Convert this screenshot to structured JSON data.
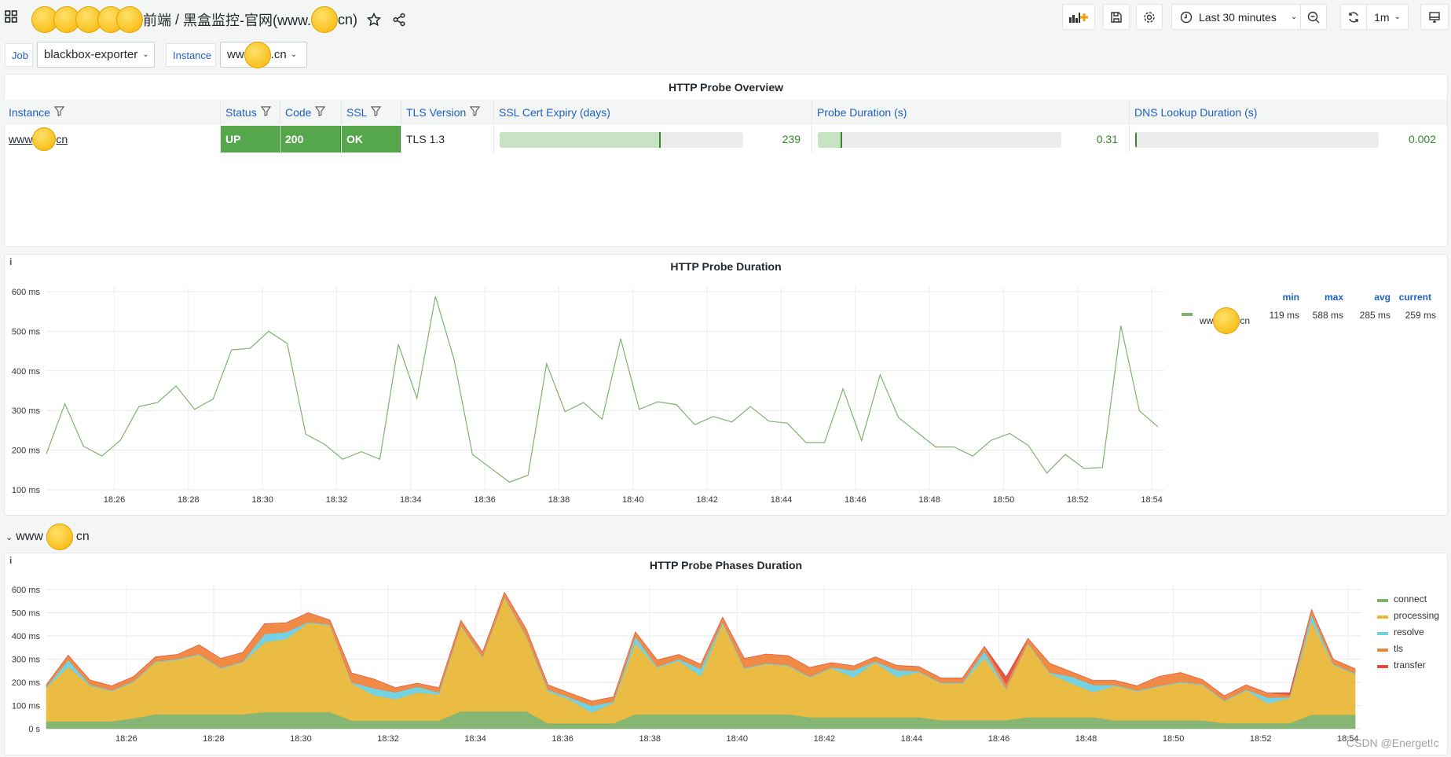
{
  "header": {
    "title_prefix": "前端",
    "title_sep": " / ",
    "title_main": "黑盒监控-官网(www.",
    "title_suffix": "cn)",
    "icons": [
      "apps-icon",
      "star-icon",
      "share-icon"
    ],
    "toolbar": {
      "time_range": "Last 30 minutes",
      "refresh_interval": "1m",
      "icons": [
        "add-panel-icon",
        "save-icon",
        "settings-icon",
        "clock-icon",
        "zoom-out-icon",
        "refresh-icon",
        "tv-mode-icon"
      ]
    }
  },
  "variables": [
    {
      "label": "Job",
      "value": "blackbox-exporter"
    },
    {
      "label": "Instance",
      "value_prefix": "ww",
      "value_suffix": ".cn"
    }
  ],
  "overview": {
    "title": "HTTP Probe Overview",
    "columns": [
      "Instance",
      "Status",
      "Code",
      "SSL",
      "TLS Version",
      "SSL Cert Expiry (days)",
      "Probe Duration (s)",
      "DNS Lookup Duration (s)"
    ],
    "row": {
      "instance_prefix": "www",
      "instance_suffix": "cn",
      "status": "UP",
      "code": "200",
      "ssl": "OK",
      "tls_version": "TLS 1.3",
      "ssl_cert_expiry": "239",
      "ssl_cert_expiry_fill": 0.66,
      "probe_duration": "0.31",
      "probe_duration_fill": 0.1,
      "dns_lookup": "0.002",
      "dns_lookup_fill": 0.005
    },
    "colors": {
      "ok": "#56a64b",
      "gauge": "#c8e3c3",
      "value": "#37872d"
    }
  },
  "row_header": {
    "prefix": "www",
    "suffix": "cn"
  },
  "chart_data": [
    {
      "type": "line",
      "title": "HTTP Probe Duration",
      "info_icon": "i",
      "ylim": [
        100,
        600
      ],
      "y_ticks": [
        "100 ms",
        "200 ms",
        "300 ms",
        "400 ms",
        "500 ms",
        "600 ms"
      ],
      "x_ticks": [
        "18:26",
        "18:28",
        "18:30",
        "18:32",
        "18:34",
        "18:36",
        "18:38",
        "18:40",
        "18:42",
        "18:44",
        "18:46",
        "18:48",
        "18:50",
        "18:52",
        "18:54"
      ],
      "grid": true,
      "legend_placement": "right",
      "legend": {
        "headers": [
          "min",
          "max",
          "avg",
          "current"
        ],
        "series_prefix": "ww",
        "series_suffix": "cn",
        "values": [
          "119 ms",
          "588 ms",
          "285 ms",
          "259 ms"
        ]
      },
      "color": "#7eb26d",
      "x": [
        "18:24:10",
        "18:24:40",
        "18:25:10",
        "18:25:40",
        "18:26:10",
        "18:26:40",
        "18:27:10",
        "18:27:40",
        "18:28:10",
        "18:28:40",
        "18:29:10",
        "18:29:40",
        "18:30:10",
        "18:30:40",
        "18:31:10",
        "18:31:40",
        "18:32:10",
        "18:32:40",
        "18:33:10",
        "18:33:40",
        "18:34:10",
        "18:34:40",
        "18:35:10",
        "18:35:40",
        "18:36:10",
        "18:36:40",
        "18:37:10",
        "18:37:40",
        "18:38:10",
        "18:38:40",
        "18:39:10",
        "18:39:40",
        "18:40:10",
        "18:40:40",
        "18:41:10",
        "18:41:40",
        "18:42:10",
        "18:42:40",
        "18:43:10",
        "18:43:40",
        "18:44:10",
        "18:44:40",
        "18:45:10",
        "18:45:40",
        "18:46:10",
        "18:46:40",
        "18:47:10",
        "18:47:40",
        "18:48:10",
        "18:48:40",
        "18:49:10",
        "18:49:40",
        "18:50:10",
        "18:50:40",
        "18:51:10",
        "18:51:40",
        "18:52:10",
        "18:52:40",
        "18:53:10",
        "18:53:40",
        "18:54:10"
      ],
      "values": [
        190,
        317,
        210,
        185,
        225,
        310,
        320,
        362,
        303,
        329,
        453,
        457,
        500,
        469,
        240,
        215,
        177,
        196,
        177,
        467,
        331,
        588,
        430,
        189,
        154,
        119,
        137,
        418,
        297,
        320,
        278,
        481,
        303,
        322,
        315,
        264,
        285,
        271,
        310,
        273,
        268,
        219,
        219,
        355,
        224,
        390,
        282,
        245,
        208,
        208,
        185,
        225,
        242,
        212,
        142,
        189,
        154,
        156,
        514,
        299,
        259
      ]
    },
    {
      "type": "area",
      "stacked": true,
      "title": "HTTP Probe Phases Duration",
      "info_icon": "i",
      "ylim": [
        0,
        600
      ],
      "y_ticks": [
        "0 s",
        "100 ms",
        "200 ms",
        "300 ms",
        "400 ms",
        "500 ms",
        "600 ms"
      ],
      "x_ticks": [
        "18:26",
        "18:28",
        "18:30",
        "18:32",
        "18:34",
        "18:36",
        "18:38",
        "18:40",
        "18:42",
        "18:44",
        "18:46",
        "18:48",
        "18:50",
        "18:52",
        "18:54"
      ],
      "grid": true,
      "legend_placement": "right",
      "series": [
        {
          "name": "connect",
          "color": "#7eb26d",
          "values": [
            32,
            32,
            32,
            32,
            45,
            62,
            62,
            62,
            62,
            62,
            72,
            72,
            72,
            72,
            35,
            35,
            35,
            35,
            35,
            75,
            75,
            75,
            75,
            23,
            23,
            23,
            23,
            62,
            62,
            62,
            62,
            62,
            62,
            62,
            62,
            49,
            49,
            49,
            49,
            49,
            49,
            37,
            37,
            37,
            37,
            49,
            49,
            49,
            49,
            36,
            36,
            36,
            36,
            36,
            24,
            24,
            24,
            24,
            60,
            60,
            60
          ]
        },
        {
          "name": "processing",
          "color": "#eab839",
          "values": [
            144,
            235,
            154,
            129,
            156,
            224,
            234,
            256,
            197,
            223,
            301,
            315,
            384,
            373,
            161,
            110,
            92,
            121,
            112,
            368,
            232,
            489,
            321,
            138,
            101,
            46,
            89,
            306,
            201,
            230,
            166,
            391,
            197,
            216,
            209,
            171,
            212,
            172,
            237,
            174,
            195,
            158,
            158,
            268,
            133,
            317,
            189,
            146,
            109,
            148,
            125,
            145,
            162,
            152,
            94,
            141,
            85,
            108,
            404,
            215,
            175
          ]
        },
        {
          "name": "resolve",
          "color": "#6ed0e0",
          "values": [
            4,
            30,
            4,
            4,
            4,
            4,
            4,
            4,
            4,
            4,
            35,
            30,
            4,
            4,
            4,
            30,
            30,
            25,
            10,
            4,
            4,
            4,
            4,
            8,
            10,
            30,
            5,
            30,
            4,
            8,
            30,
            8,
            4,
            4,
            4,
            4,
            4,
            30,
            4,
            30,
            4,
            4,
            4,
            30,
            4,
            4,
            4,
            30,
            30,
            4,
            4,
            4,
            4,
            4,
            4,
            4,
            25,
            4,
            30,
            4,
            4
          ]
        },
        {
          "name": "tls",
          "color": "#ef843c",
          "values": [
            10,
            20,
            20,
            20,
            20,
            20,
            20,
            40,
            40,
            40,
            45,
            40,
            40,
            20,
            40,
            40,
            20,
            15,
            20,
            20,
            20,
            20,
            30,
            20,
            20,
            20,
            20,
            20,
            30,
            20,
            20,
            20,
            40,
            40,
            40,
            40,
            20,
            20,
            20,
            20,
            20,
            20,
            20,
            20,
            20,
            20,
            40,
            20,
            20,
            20,
            20,
            40,
            40,
            20,
            20,
            20,
            20,
            10,
            20,
            20,
            20
          ]
        },
        {
          "name": "transfer",
          "color": "#e24d42",
          "values": [
            0,
            0,
            0,
            0,
            0,
            0,
            0,
            0,
            0,
            0,
            0,
            0,
            0,
            0,
            0,
            0,
            0,
            0,
            0,
            0,
            0,
            0,
            0,
            0,
            0,
            0,
            0,
            0,
            0,
            0,
            0,
            0,
            0,
            0,
            0,
            0,
            0,
            0,
            0,
            0,
            0,
            0,
            0,
            0,
            30,
            0,
            0,
            0,
            0,
            0,
            0,
            0,
            0,
            0,
            0,
            0,
            0,
            10,
            0,
            0,
            0
          ]
        }
      ]
    }
  ],
  "watermark": "CSDN @Energet!c"
}
